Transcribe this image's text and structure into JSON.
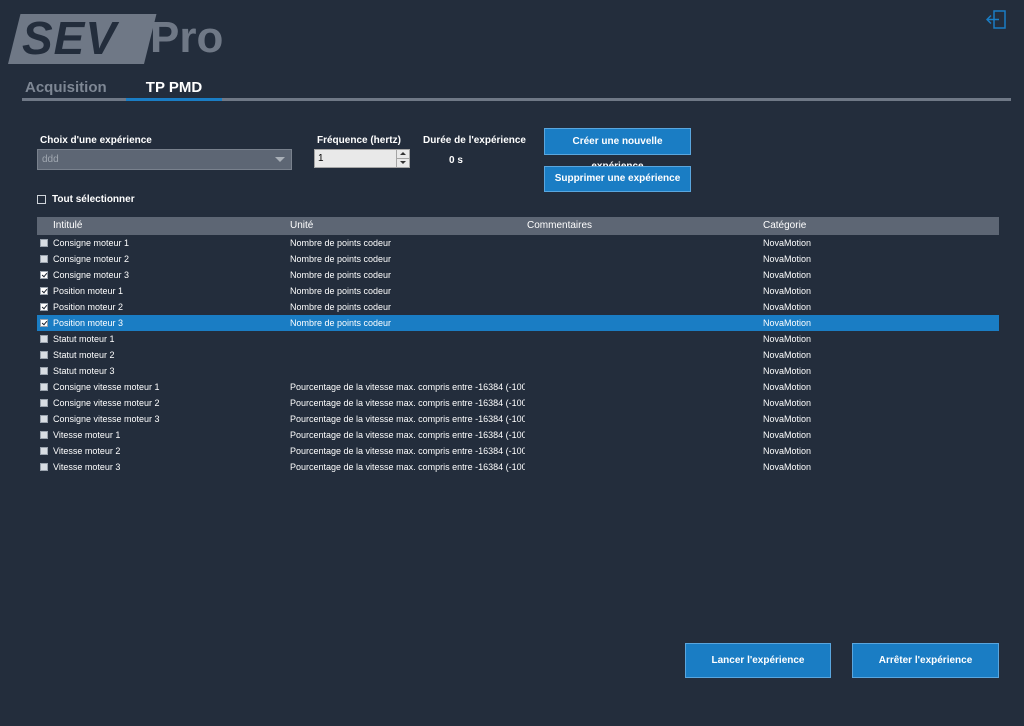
{
  "app": {
    "logo_left": "SEV",
    "logo_right": "Pro"
  },
  "header": {
    "exit_icon": "exit-icon"
  },
  "tabs": [
    {
      "label": "Acquisition",
      "active": false
    },
    {
      "label": "TP PMD",
      "active": true
    }
  ],
  "form": {
    "experiment_label": "Choix d'une expérience",
    "experiment_value": "ddd",
    "frequency_label": "Fréquence (hertz)",
    "frequency_value": "1",
    "duration_label": "Durée de l'expérience",
    "duration_value": "0 s",
    "create_button": "Créer une nouvelle expérience",
    "delete_button": "Supprimer une expérience",
    "select_all_label": "Tout sélectionner"
  },
  "table": {
    "columns": [
      "Intitulé",
      "Unité",
      "Commentaires",
      "Catégorie"
    ],
    "rows": [
      {
        "title": "Consigne moteur 1",
        "unit": "Nombre de points codeur",
        "comment": "",
        "category": "NovaMotion",
        "checked": false,
        "selected": false
      },
      {
        "title": "Consigne moteur 2",
        "unit": "Nombre de points codeur",
        "comment": "",
        "category": "NovaMotion",
        "checked": false,
        "selected": false
      },
      {
        "title": "Consigne moteur 3",
        "unit": "Nombre de points codeur",
        "comment": "",
        "category": "NovaMotion",
        "checked": true,
        "selected": false
      },
      {
        "title": "Position moteur 1",
        "unit": "Nombre de points codeur",
        "comment": "",
        "category": "NovaMotion",
        "checked": true,
        "selected": false
      },
      {
        "title": "Position moteur 2",
        "unit": "Nombre de points codeur",
        "comment": "",
        "category": "NovaMotion",
        "checked": true,
        "selected": false
      },
      {
        "title": "Position moteur 3",
        "unit": "Nombre de points codeur",
        "comment": "",
        "category": "NovaMotion",
        "checked": true,
        "selected": true
      },
      {
        "title": "Statut moteur 1",
        "unit": "",
        "comment": "",
        "category": "NovaMotion",
        "checked": false,
        "selected": false
      },
      {
        "title": "Statut moteur 2",
        "unit": "",
        "comment": "",
        "category": "NovaMotion",
        "checked": false,
        "selected": false
      },
      {
        "title": "Statut moteur 3",
        "unit": "",
        "comment": "",
        "category": "NovaMotion",
        "checked": false,
        "selected": false
      },
      {
        "title": "Consigne vitesse moteur 1",
        "unit": "Pourcentage de la vitesse max. compris entre -16384 (-100...",
        "comment": "",
        "category": "NovaMotion",
        "checked": false,
        "selected": false
      },
      {
        "title": "Consigne vitesse moteur 2",
        "unit": "Pourcentage de la vitesse max. compris entre -16384 (-100...",
        "comment": "",
        "category": "NovaMotion",
        "checked": false,
        "selected": false
      },
      {
        "title": "Consigne vitesse moteur 3",
        "unit": "Pourcentage de la vitesse max. compris entre -16384 (-100...",
        "comment": "",
        "category": "NovaMotion",
        "checked": false,
        "selected": false
      },
      {
        "title": "Vitesse moteur 1",
        "unit": "Pourcentage de la vitesse max. compris entre -16384 (-100...",
        "comment": "",
        "category": "NovaMotion",
        "checked": false,
        "selected": false
      },
      {
        "title": "Vitesse moteur 2",
        "unit": "Pourcentage de la vitesse max. compris entre -16384 (-100...",
        "comment": "",
        "category": "NovaMotion",
        "checked": false,
        "selected": false
      },
      {
        "title": "Vitesse moteur 3",
        "unit": "Pourcentage de la vitesse max. compris entre -16384 (-100...",
        "comment": "",
        "category": "NovaMotion",
        "checked": false,
        "selected": false
      }
    ]
  },
  "footer": {
    "launch_button": "Lancer l'expérience",
    "stop_button": "Arrêter l'expérience"
  },
  "colors": {
    "background": "#232d3c",
    "accent": "#1a7dc4",
    "header_row": "#5d6674",
    "logo_gray": "#6f7886"
  }
}
